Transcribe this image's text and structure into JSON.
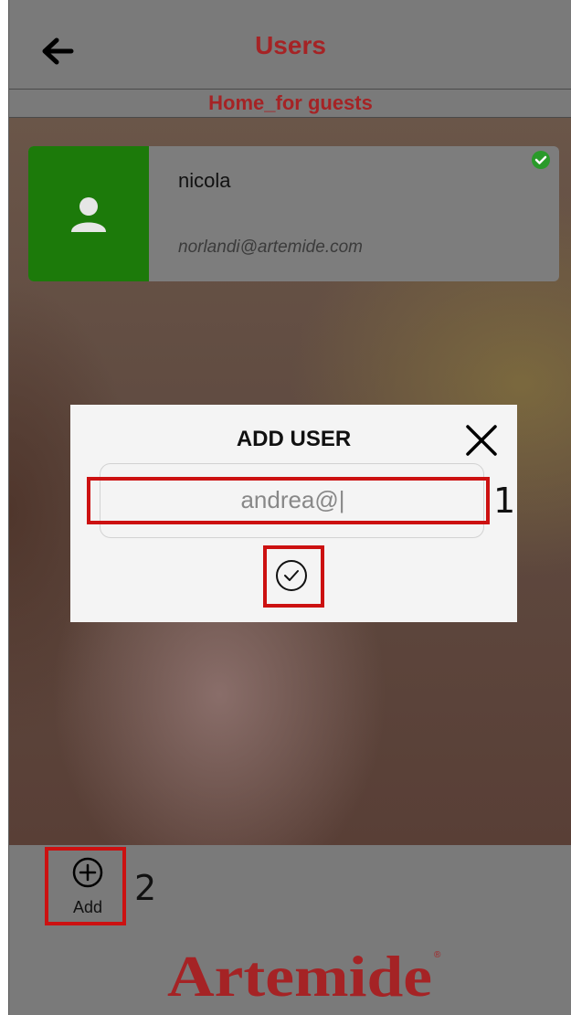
{
  "header": {
    "title": "Users",
    "subtitle": "Home_for guests",
    "back_icon": "arrow-left-icon"
  },
  "users": [
    {
      "name": "nicola",
      "email": "norlandi@artemide.com",
      "status": "verified",
      "avatar_icon": "person-icon",
      "avatar_color": "#1c7a0a"
    }
  ],
  "modal": {
    "title": "ADD USER",
    "input_value": "andrea@|",
    "close_icon": "close-icon",
    "confirm_icon": "check-circle-icon"
  },
  "annotations": [
    "1",
    "2"
  ],
  "bottom": {
    "add_label": "Add",
    "add_icon": "plus-circle-icon"
  },
  "brand": {
    "name": "Artemide",
    "color": "#a52325"
  },
  "colors": {
    "accent": "#a52325",
    "bar": "#7a7a7a",
    "highlight": "#cc1111",
    "success": "#1c7a0a"
  }
}
